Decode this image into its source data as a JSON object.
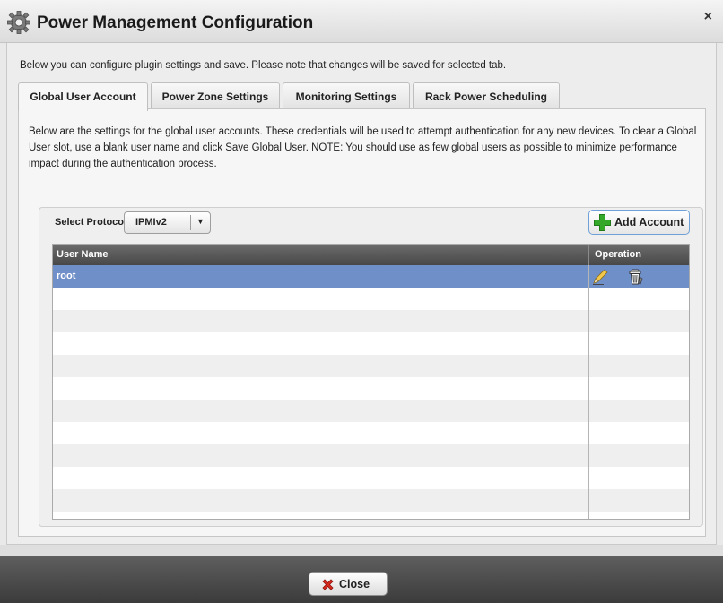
{
  "window": {
    "title": "Power Management Configuration",
    "close_glyph": "×",
    "title_icon": "gear-icon"
  },
  "intro_text": "Below you can configure plugin settings and save. Please note that changes will be saved for selected tab.",
  "tabs": [
    {
      "label": "Global User Account",
      "active": true
    },
    {
      "label": "Power Zone Settings",
      "active": false
    },
    {
      "label": "Monitoring Settings",
      "active": false
    },
    {
      "label": "Rack Power Scheduling",
      "active": false
    }
  ],
  "description": "Below are the settings for the global user accounts.  These credentials will be used to attempt authentication for any new devices.  To clear a Global User slot, use a blank user name and click Save Global User.  NOTE: You should use as few global users as possible to minimize performance impact during the authentication process.",
  "protocol": {
    "label": "Select Protocol:",
    "selected": "IPMIv2",
    "arrow_glyph": "▼"
  },
  "add_account": {
    "label": "Add Account",
    "icon": "green-plus-icon"
  },
  "grid": {
    "columns": [
      "User Name",
      "Operation"
    ],
    "rows": [
      {
        "user_name": "root",
        "selected": true
      }
    ],
    "operation_icons": [
      "pencil-edit-icon",
      "trash-delete-icon"
    ]
  },
  "footer": {
    "close_label": "Close",
    "close_icon": "red-x-icon"
  },
  "colors": {
    "selected_row": "#6f8fc8",
    "header_bg": "#555555",
    "accent_border": "#6fa0d8",
    "add_green": "#35a82a",
    "close_red": "#d62a1e"
  }
}
